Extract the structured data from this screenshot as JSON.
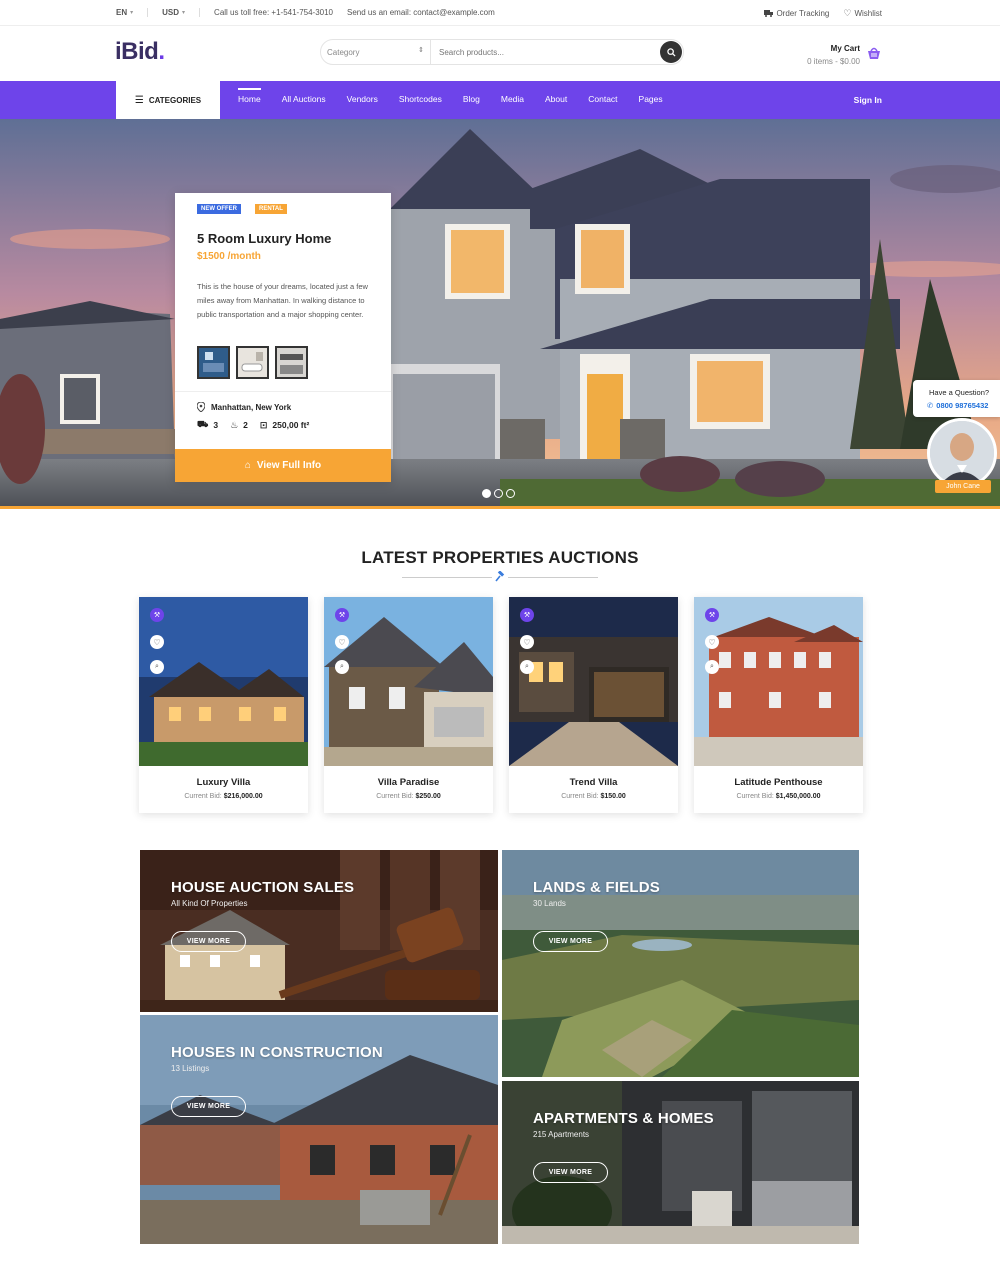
{
  "topbar": {
    "language": "EN",
    "currency": "USD",
    "phone": "Call us toll free: +1-541-754-3010",
    "email": "Send us an email: contact@example.com",
    "order_tracking": "Order Tracking",
    "wishlist": "Wishlist"
  },
  "header": {
    "logo": "iBid",
    "logo_dot": ".",
    "category_select": "Category",
    "search_placeholder": "Search products...",
    "cart_title": "My Cart",
    "cart_summary": "0 items - $0.00"
  },
  "nav": {
    "categories": "CATEGORIES",
    "links": [
      "Home",
      "All Auctions",
      "Vendors",
      "Shortcodes",
      "Blog",
      "Media",
      "About",
      "Contact",
      "Pages"
    ],
    "active": "Home",
    "sign_in": "Sign In"
  },
  "hero": {
    "badge_new": "NEW OFFER",
    "badge_rental": "RENTAL",
    "title": "5 Room Luxury Home",
    "price": "$1500 /month",
    "description": "This is the house of your dreams, located just a few miles away from Manhattan. In walking distance to public transportation and a major shopping center.",
    "location": "Manhattan, New York",
    "beds": "3",
    "baths": "2",
    "area": "250,00 ft²",
    "cta": "View Full Info",
    "slide_count": 3,
    "active_slide": 1
  },
  "contact_widget": {
    "question": "Have a Question?",
    "phone": "0800 98765432",
    "agent_name": "John Cane"
  },
  "auctions": {
    "title": "LATEST PROPERTIES AUCTIONS",
    "bid_label": "Current Bid:",
    "items": [
      {
        "name": "Luxury Villa",
        "bid": "$216,000.00"
      },
      {
        "name": "Villa Paradise",
        "bid": "$250.00"
      },
      {
        "name": "Trend Villa",
        "bid": "$150.00"
      },
      {
        "name": "Latitude Penthouse",
        "bid": "$1,450,000.00"
      }
    ]
  },
  "categories": {
    "view_more": "VIEW MORE",
    "tiles": [
      {
        "title": "HOUSE AUCTION SALES",
        "subtitle": "All Kind Of Properties"
      },
      {
        "title": "LANDS & FIELDS",
        "subtitle": "30 Lands"
      },
      {
        "title": "HOUSES IN CONSTRUCTION",
        "subtitle": "13 Listings"
      },
      {
        "title": "APARTMENTS & HOMES",
        "subtitle": "215 Apartments"
      }
    ]
  },
  "colors": {
    "brand_purple": "#6e44ea",
    "accent_orange": "#f7a535",
    "link_blue": "#1e6fd9"
  }
}
